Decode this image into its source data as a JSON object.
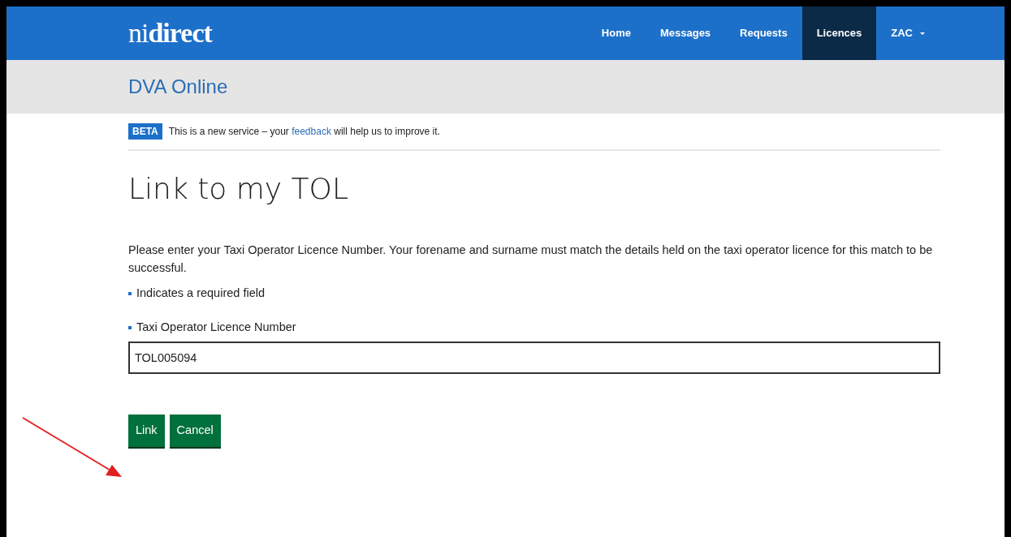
{
  "header": {
    "logo": "ni**direct**",
    "nav": [
      {
        "label": "Home",
        "selected": false
      },
      {
        "label": "Messages",
        "selected": false
      },
      {
        "label": "Requests",
        "selected": false
      },
      {
        "label": "Licences",
        "selected": true
      },
      {
        "label": "ZAC",
        "selected": false,
        "kind": "dropdown"
      }
    ]
  },
  "service_name": "DVA Online",
  "beta_banner": {
    "tag": "BETA",
    "text_before": "This is a new service – your",
    "link": "feedback",
    "text_after": "will help us to improve it."
  },
  "heading": "Link to my TOL",
  "intro": "Please enter your Taxi Operator Licence Number. Your forename and surname must match the details held on the taxi operator licence for this match to be successful.",
  "required_note": "Indicates a required field",
  "field": {
    "label": "Taxi Operator Licence Number",
    "value": "TOL005094",
    "required": true
  },
  "buttons": [
    "Link",
    "Cancel"
  ]
}
